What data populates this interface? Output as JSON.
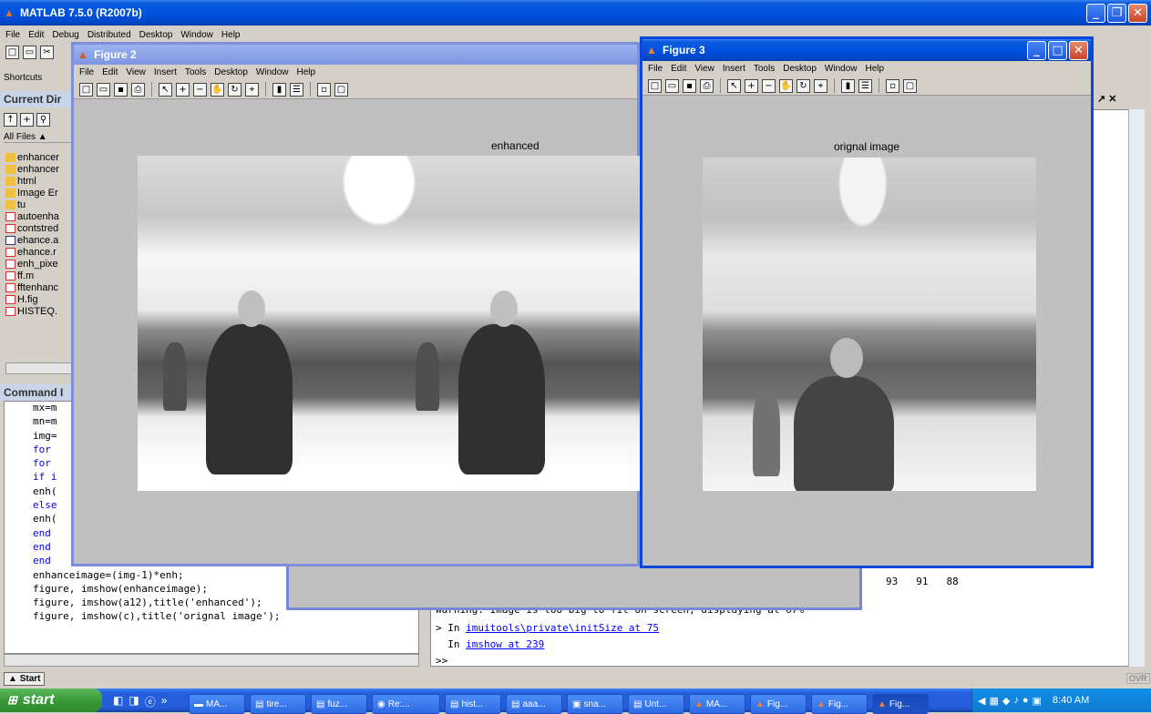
{
  "matlab": {
    "title": "MATLAB 7.5.0 (R2007b)",
    "menu": [
      "File",
      "Edit",
      "Debug",
      "Distributed",
      "Desktop",
      "Window",
      "Help"
    ],
    "shortcuts": "Shortcuts",
    "current_dir_label": "Current Dir",
    "all_files": "All Files",
    "files": [
      "enhancer",
      "enhancer",
      "html",
      "Image Er",
      "tu",
      "autoenha",
      "contstred",
      "ehance.a",
      "ehance.r",
      "enh_pixe",
      "ff.m",
      "fftenhanc",
      "H.fig",
      "HISTEQ."
    ],
    "command_label": "Command I",
    "start_btn": "Start",
    "ovr": "OVR"
  },
  "code_lines": [
    "mx=m",
    "mn=m",
    "img=",
    "for",
    "for",
    "if i",
    "enh(",
    "else",
    "enh(",
    "end",
    "end",
    "end",
    "enhanceimage=(img-1)*enh;",
    "figure, imshow(enhanceimage);",
    "figure, imshow(a12),title('enhanced');",
    "figure, imshow(c),title('orignal image');"
  ],
  "cmd": {
    "numbers": [
      "93",
      "91",
      "88"
    ],
    "warning": "Warning: Image is too big to fit on screen; displaying at 67%",
    "line1_prefix": "> In ",
    "line1_link": "imuitools\\private\\initSize at 75",
    "line2_prefix": "In ",
    "line2_link": "imshow at 239",
    "prompt": ">>"
  },
  "fig2": {
    "title": "Figure 2",
    "menu": [
      "File",
      "Edit",
      "View",
      "Insert",
      "Tools",
      "Desktop",
      "Window",
      "Help"
    ],
    "caption": "enhanced"
  },
  "fig3": {
    "title": "Figure 3",
    "menu": [
      "File",
      "Edit",
      "View",
      "Insert",
      "Tools",
      "Desktop",
      "Window",
      "Help"
    ],
    "caption": "orignal image"
  },
  "taskbar": {
    "start": "start",
    "buttons": [
      "MA...",
      "tire...",
      "fuz...",
      "Re:...",
      "hist...",
      "aaa...",
      "sna...",
      "Unt...",
      "MA...",
      "Fig...",
      "Fig...",
      "Fig..."
    ],
    "clock": "8:40 AM"
  }
}
